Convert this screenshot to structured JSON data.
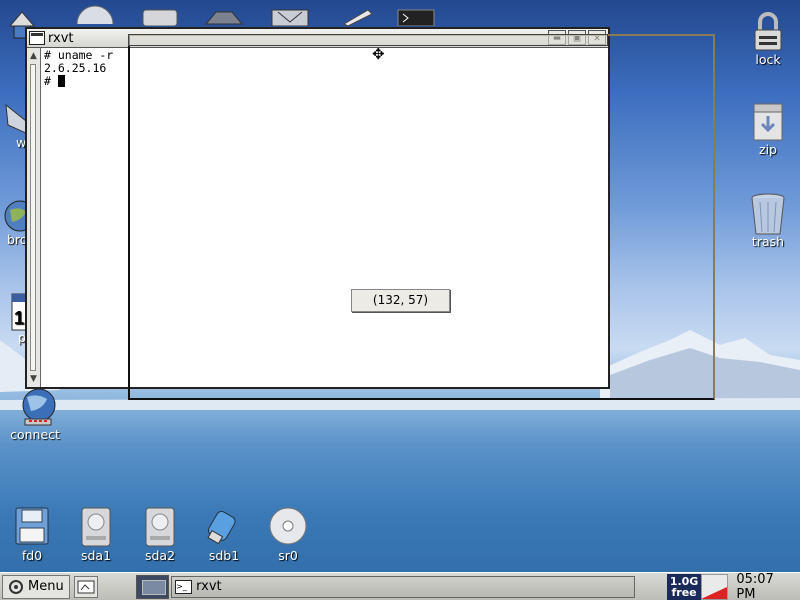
{
  "desktop": {
    "right_icons": [
      {
        "label": "lock",
        "icon": "lock-icon"
      },
      {
        "label": "zip",
        "icon": "zip-folder-icon"
      },
      {
        "label": "trash",
        "icon": "trash-icon"
      }
    ],
    "left_icons": [
      {
        "label": "w",
        "icon": "window-icon"
      },
      {
        "label": "bro",
        "icon": "browser-globe-icon"
      },
      {
        "label": "p",
        "icon": "calendar-icon"
      },
      {
        "label": "connect",
        "icon": "connect-globe-icon"
      }
    ],
    "bottom_icons": [
      {
        "label": "fd0",
        "icon": "floppy-icon"
      },
      {
        "label": "sda1",
        "icon": "harddisk-icon"
      },
      {
        "label": "sda2",
        "icon": "harddisk-icon"
      },
      {
        "label": "sdb1",
        "icon": "usb-drive-icon"
      },
      {
        "label": "sr0",
        "icon": "cdrom-icon"
      }
    ]
  },
  "window": {
    "title": "rxvt",
    "buttons": {
      "minimize": "▬",
      "maximize": "▣",
      "close": "✕"
    },
    "terminal_lines": [
      "# uname -r",
      "2.6.25.16",
      "# "
    ]
  },
  "move_feedback": {
    "coords": "(132, 57)"
  },
  "taskbar": {
    "menu_label": "Menu",
    "task_label": "rxvt",
    "disk_free_size": "1.0G",
    "disk_free_text": "free",
    "clock": "05:07 PM"
  }
}
